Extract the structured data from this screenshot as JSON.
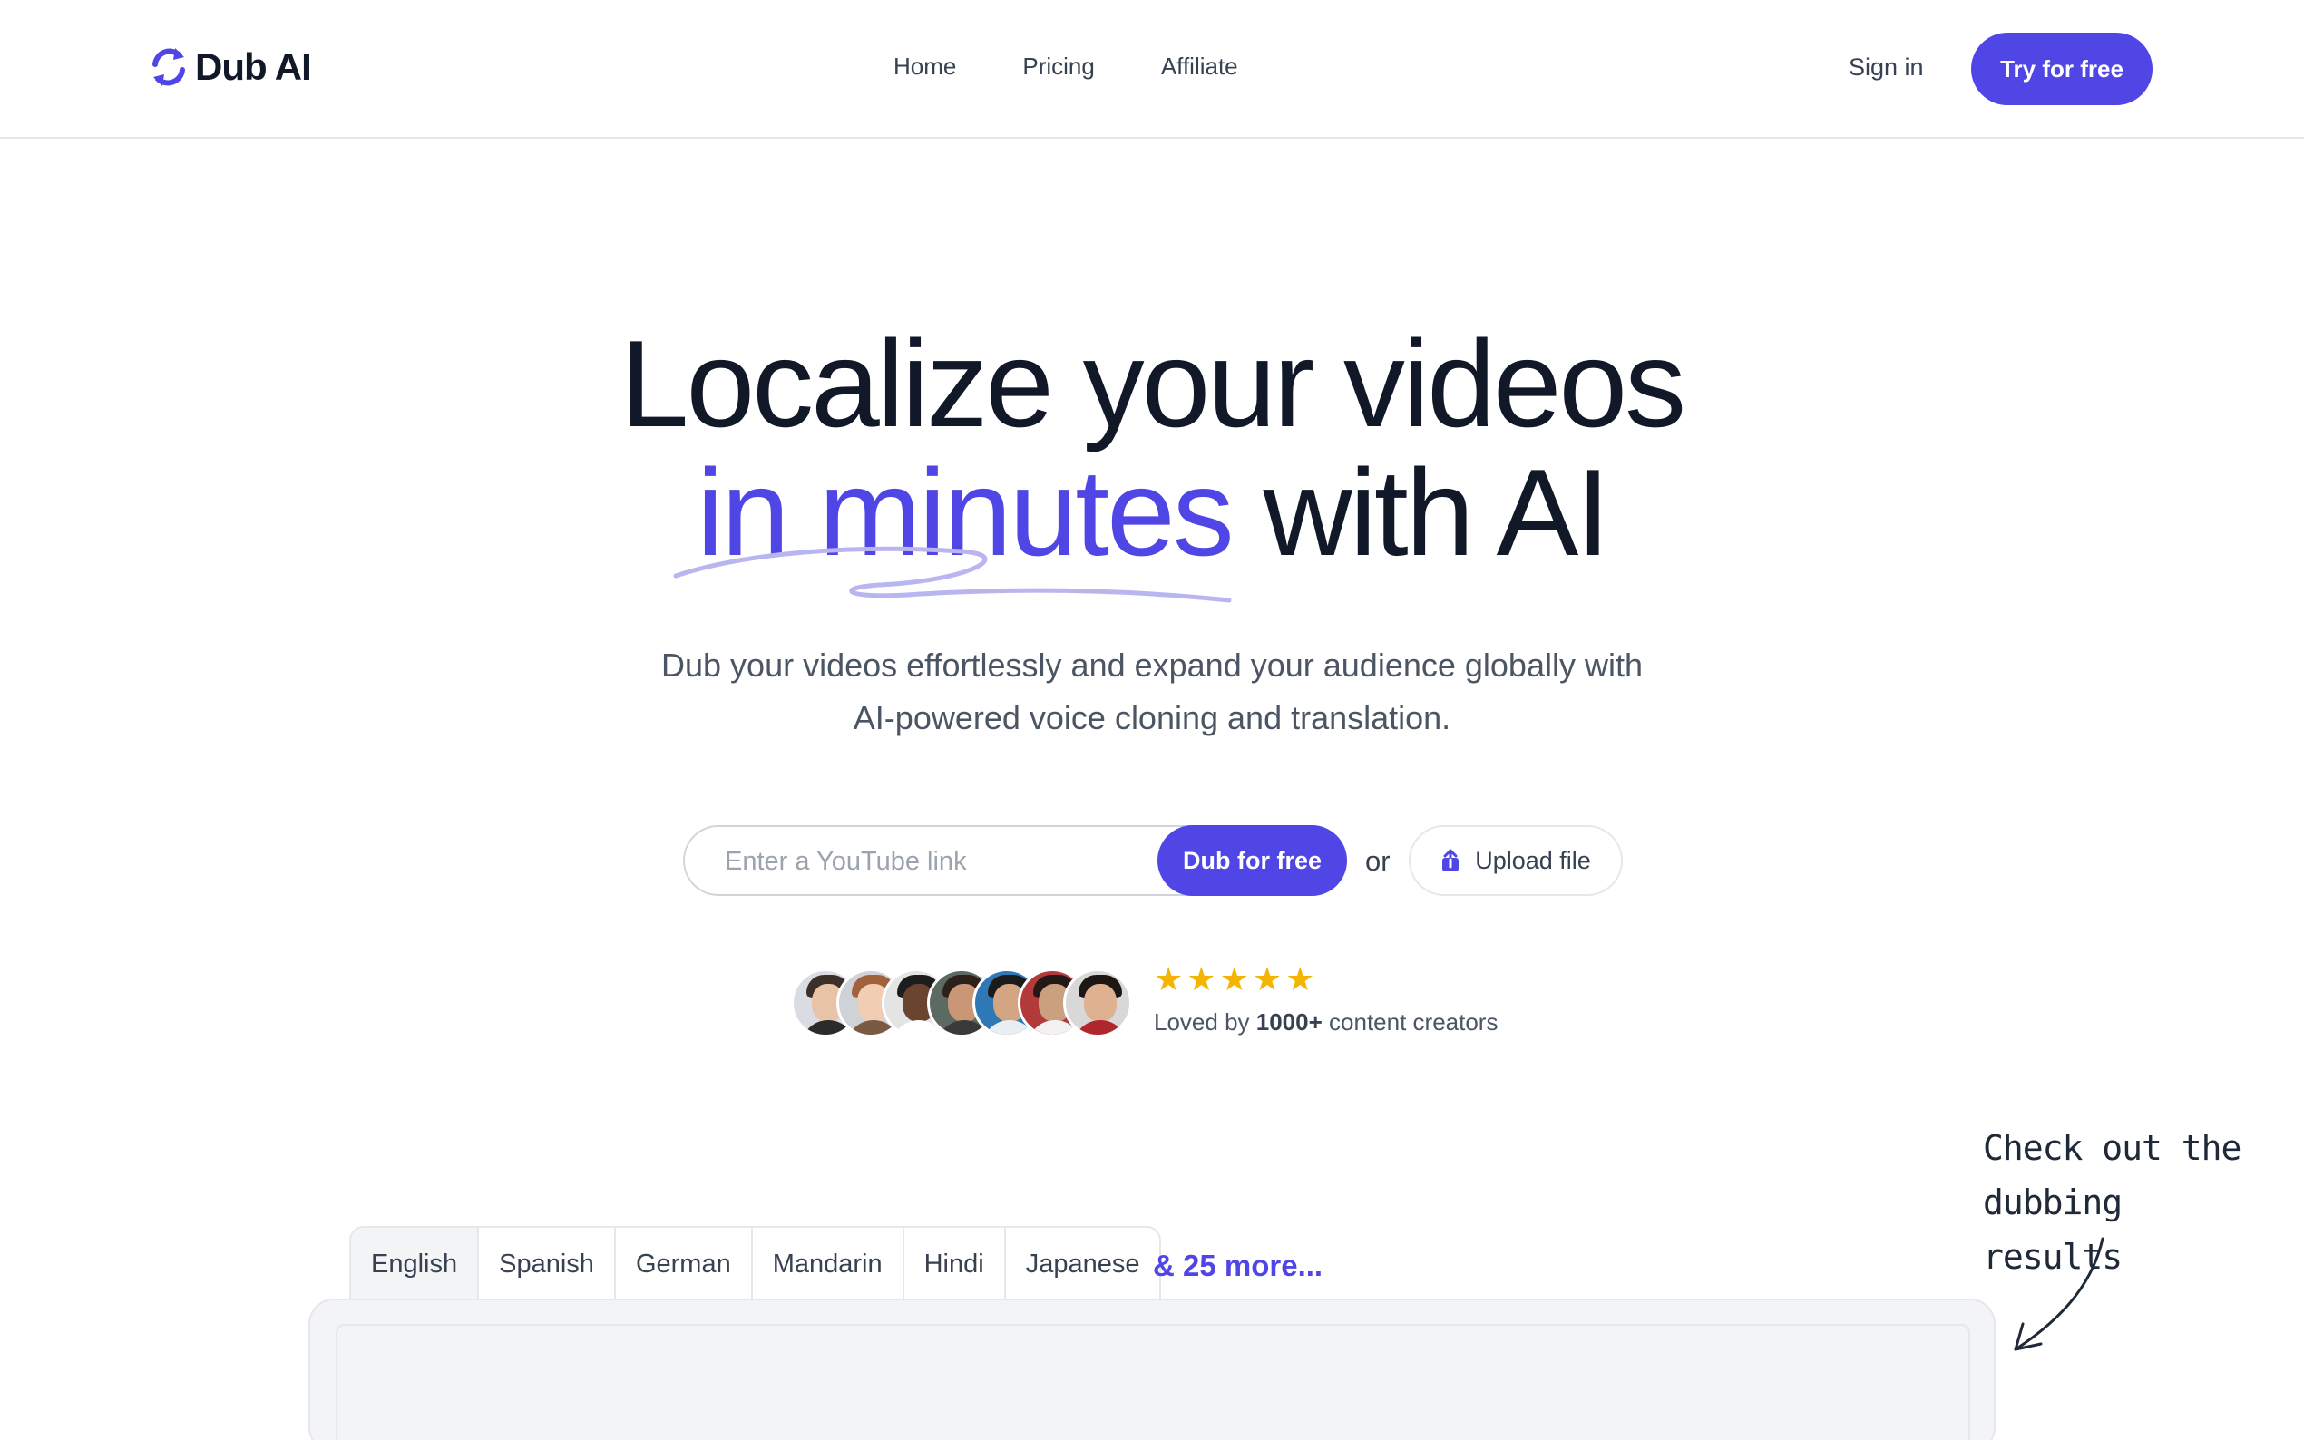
{
  "header": {
    "logo_text": "Dub AI",
    "nav": [
      "Home",
      "Pricing",
      "Affiliate"
    ],
    "sign_in": "Sign in",
    "cta": "Try for free"
  },
  "hero": {
    "line1": "Localize your videos",
    "line2_accent": "in minutes",
    "line2_rest": "with AI",
    "subtitle_line1": "Dub your videos effortlessly and expand your audience globally with",
    "subtitle_line2": "AI-powered voice cloning and translation."
  },
  "input": {
    "placeholder": "Enter a YouTube link",
    "value": "",
    "dub_button": "Dub for free",
    "or": "or",
    "upload_button": "Upload file"
  },
  "social": {
    "rating_stars": 5,
    "loved_prefix": "Loved by",
    "loved_count": "1000+",
    "loved_suffix": "content creators"
  },
  "annotation": {
    "line1": "Check out the",
    "line2": "dubbing results"
  },
  "languages": {
    "tabs": [
      "English",
      "Spanish",
      "German",
      "Mandarin",
      "Hindi",
      "Japanese"
    ],
    "active": "English",
    "more": "& 25 more..."
  },
  "colors": {
    "accent": "#4f46e5",
    "accent_text": "#5046e5",
    "star": "#f5b400",
    "text_dark": "#111827",
    "text_muted": "#4b5563"
  },
  "icons": {
    "logo": "refresh-arrows-icon",
    "upload": "upload-icon",
    "star": "star-icon",
    "note_arrow": "curved-arrow-icon"
  }
}
